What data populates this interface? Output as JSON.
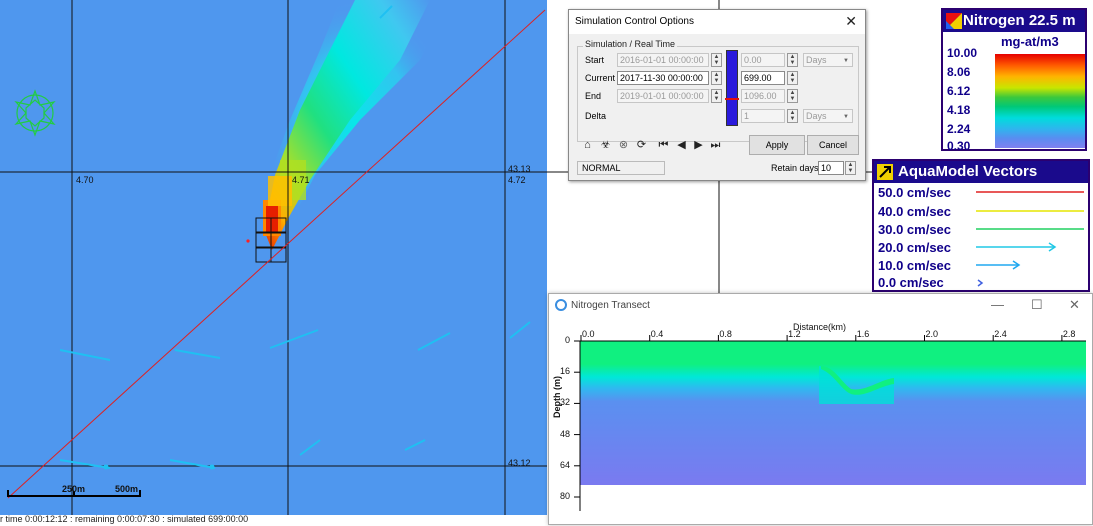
{
  "map": {
    "grid_labels": {
      "lon_470": "4.70",
      "lon_471": "4.71",
      "lat_4313_right": "43.13",
      "lon_472_right": "4.72",
      "lat_4312_right": "43.12",
      "mid_small_label": "4.70"
    },
    "scale_bar": {
      "label_250": "250m",
      "label_500": "500m"
    },
    "compass": "compass-rose-icon",
    "status_text": "r time 0:00:12:12 : remaining 0:00:07:30 : simulated 699:00:00",
    "colors": {
      "background": "#4f97ee",
      "transect_line": "#e02020",
      "vector_arrows": "#1fc0f2"
    }
  },
  "sim_dialog": {
    "title": "Simulation Control Options",
    "group_label": "Simulation / Real Time",
    "rows": [
      {
        "label": "Start",
        "datetime": "2016-01-01 00:00:00",
        "number": "0.00",
        "unit": "Days"
      },
      {
        "label": "Current",
        "datetime": "2017-11-30 00:00:00",
        "number": "699.00",
        "unit": ""
      },
      {
        "label": "End",
        "datetime": "2019-01-01 00:00:00",
        "number": "1096.00",
        "unit": ""
      },
      {
        "label": "Delta",
        "datetime": "",
        "number": "1",
        "unit": "Days"
      }
    ],
    "progress_fraction": 0.64,
    "apply_label": "Apply",
    "cancel_label": "Cancel",
    "mode": "NORMAL",
    "retain_label": "Retain days",
    "retain_value": "10",
    "toolbar_icons": [
      "home-icon",
      "bio-icon",
      "stop-icon",
      "refresh-icon",
      "skip-start-icon",
      "step-back-icon",
      "play-icon",
      "skip-end-icon"
    ]
  },
  "nitrogen_legend": {
    "title": "Nitrogen 22.5 m",
    "unit": "mg-at/m3",
    "ticks": [
      "10.00",
      "8.06",
      "6.12",
      "4.18",
      "2.24",
      "0.30"
    ],
    "colors": {
      "header": "#1a0a8c"
    }
  },
  "vector_legend": {
    "title": "AquaModel Vectors",
    "items": [
      {
        "label": "50.0 cm/sec",
        "color": "#e02020"
      },
      {
        "label": "40.0 cm/sec",
        "color": "#e6e600"
      },
      {
        "label": "30.0 cm/sec",
        "color": "#20d060"
      },
      {
        "label": "20.0 cm/sec",
        "color": "#20c8e6"
      },
      {
        "label": "10.0 cm/sec",
        "color": "#20a8f0"
      },
      {
        "label": "0.0 cm/sec",
        "color": "#4060e0"
      }
    ]
  },
  "transect": {
    "title": "Nitrogen Transect",
    "x_axis_label": "Distance(km)",
    "x_ticks": [
      "0.0",
      "0.4",
      "0.8",
      "1.2",
      "1.6",
      "2.0",
      "2.4",
      "2.8"
    ],
    "y_axis_label": "Depth (m)",
    "y_ticks": [
      "0",
      "16",
      "32",
      "48",
      "64",
      "80"
    ]
  }
}
